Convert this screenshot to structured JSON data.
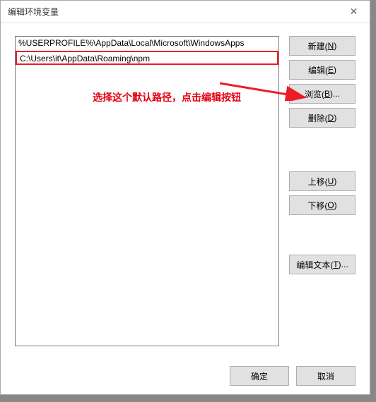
{
  "titlebar": {
    "title": "编辑环境变量"
  },
  "list": {
    "items": [
      "%USERPROFILE%\\AppData\\Local\\Microsoft\\WindowsApps",
      "C:\\Users\\it\\AppData\\Roaming\\npm"
    ],
    "selected_index": 1
  },
  "buttons": {
    "new": "新建(",
    "new_u": "N",
    "new_end": ")",
    "edit": "编辑(",
    "edit_u": "E",
    "edit_end": ")",
    "browse": "浏览(",
    "browse_u": "B",
    "browse_end": ")...",
    "delete": "删除(",
    "delete_u": "D",
    "delete_end": ")",
    "moveup": "上移(",
    "moveup_u": "U",
    "moveup_end": ")",
    "movedown": "下移(",
    "movedown_u": "O",
    "movedown_end": ")",
    "edittext": "编辑文本(",
    "edittext_u": "T",
    "edittext_end": ")..."
  },
  "footer": {
    "ok": "确定",
    "cancel": "取消"
  },
  "annotation": {
    "text": "选择这个默认路径，点击编辑按钮"
  }
}
